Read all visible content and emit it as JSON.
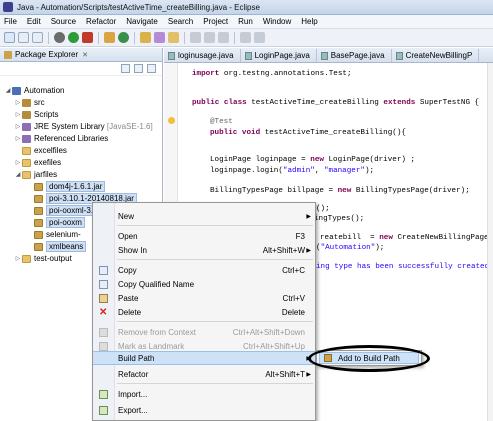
{
  "window": {
    "title": "Java - Automation/Scripts/testActiveTime_createBilling.java - Eclipse"
  },
  "menubar": [
    "File",
    "Edit",
    "Source",
    "Refactor",
    "Navigate",
    "Search",
    "Project",
    "Run",
    "Window",
    "Help"
  ],
  "package_explorer": {
    "tab_label": "Package Explorer",
    "close_glyph": "✕",
    "tree": [
      {
        "label": "Automation",
        "icon": "project-icon"
      },
      {
        "label": "src",
        "icon": "package-folder-icon"
      },
      {
        "label": "Scripts",
        "icon": "package-folder-icon"
      },
      {
        "label": "JRE System Library",
        "suffix": "[JavaSE-1.6]",
        "icon": "library-icon"
      },
      {
        "label": "Referenced Libraries",
        "icon": "library-icon"
      },
      {
        "label": "excelfiles",
        "icon": "folder-icon"
      },
      {
        "label": "exefiles",
        "icon": "folder-icon"
      },
      {
        "label": "jarfiles",
        "icon": "folder-icon"
      },
      {
        "label": "dom4j-1.6.1.jar",
        "icon": "jar-icon"
      },
      {
        "label": "poi-3.10.1-20140818.jar",
        "icon": "jar-icon"
      },
      {
        "label": "poi-ooxml-3.10.1-20140818.jar",
        "icon": "jar-icon"
      },
      {
        "label": "poi-ooxm",
        "icon": "jar-icon"
      },
      {
        "label": "selenium-",
        "icon": "jar-icon"
      },
      {
        "label": "xmlbeans",
        "icon": "jar-icon"
      },
      {
        "label": "test-output",
        "icon": "folder-icon"
      }
    ]
  },
  "editor": {
    "tabs": [
      "loginusage.java",
      "LoginPage.java",
      "BasePage.java",
      "CreateNewBillingP"
    ],
    "code": {
      "import_kw": "import",
      "import_rest": " org.testng.annotations.Test;",
      "class_kw1": "public class",
      "class_rest": " testActiveTime_createBilling ",
      "class_kw2": "extends",
      "class_rest2": " SuperTestNG {",
      "annotation": "@Test",
      "method_kw": "public void",
      "method_rest": " testActiveTime_createBilling(){",
      "l1a": "LoginPage loginpage = ",
      "l1kw": "new",
      "l1b": " LoginPage(driver) ;",
      "l2a": "loginpage.login(",
      "l2s1": "\"admin\"",
      "l2b": ", ",
      "l2s2": "\"manager\"",
      "l2c": ");",
      "l3a": "BillingTypesPage billpage = ",
      "l3kw": "new",
      "l3b": " BillingTypesPage(driver);",
      "l4": "();",
      "l5": "ingTypes();",
      "l6a": "reatebill  = ",
      "l6kw": "new",
      "l6b": " CreateNewBillingPage(dr",
      "l7a": "(",
      "l7s": "\"Automation\"",
      "l7b": ");",
      "l8": "ing type has been successfully created."
    }
  },
  "context_menu": {
    "items": [
      {
        "label": "New",
        "shortcut": "",
        "submenu": true,
        "disabled": false,
        "icon": ""
      },
      {
        "label": "Open",
        "shortcut": "F3",
        "submenu": false,
        "disabled": false,
        "icon": ""
      },
      {
        "label": "Show In",
        "shortcut": "Alt+Shift+W",
        "submenu": true,
        "disabled": false,
        "icon": ""
      },
      {
        "label": "Copy",
        "shortcut": "Ctrl+C",
        "submenu": false,
        "disabled": false,
        "icon": "copy-icon"
      },
      {
        "label": "Copy Qualified Name",
        "shortcut": "",
        "submenu": false,
        "disabled": false,
        "icon": "copy-qualified-icon"
      },
      {
        "label": "Paste",
        "shortcut": "Ctrl+V",
        "submenu": false,
        "disabled": false,
        "icon": "paste-icon"
      },
      {
        "label": "Delete",
        "shortcut": "Delete",
        "submenu": false,
        "disabled": false,
        "icon": "delete-icon"
      },
      {
        "label": "Remove from Context",
        "shortcut": "Ctrl+Alt+Shift+Down",
        "submenu": false,
        "disabled": true,
        "icon": "remove-context-icon"
      },
      {
        "label": "Mark as Landmark",
        "shortcut": "Ctrl+Alt+Shift+Up",
        "submenu": false,
        "disabled": true,
        "icon": "landmark-icon"
      },
      {
        "label": "Build Path",
        "shortcut": "",
        "submenu": true,
        "disabled": false,
        "icon": "",
        "highlighted": true
      },
      {
        "label": "Refactor",
        "shortcut": "Alt+Shift+T",
        "submenu": true,
        "disabled": false,
        "icon": ""
      },
      {
        "label": "Import...",
        "shortcut": "",
        "submenu": false,
        "disabled": false,
        "icon": "import-icon"
      },
      {
        "label": "Export...",
        "shortcut": "",
        "submenu": false,
        "disabled": false,
        "icon": "export-icon"
      }
    ],
    "submenu_arrow": "▶"
  },
  "build_path_submenu": {
    "item_label": "Add to Build Path"
  },
  "colors": {
    "highlight": "#cde2f7",
    "keyword": "#7f0055",
    "string": "#2a00ff",
    "comment": "#3f7f5f"
  }
}
